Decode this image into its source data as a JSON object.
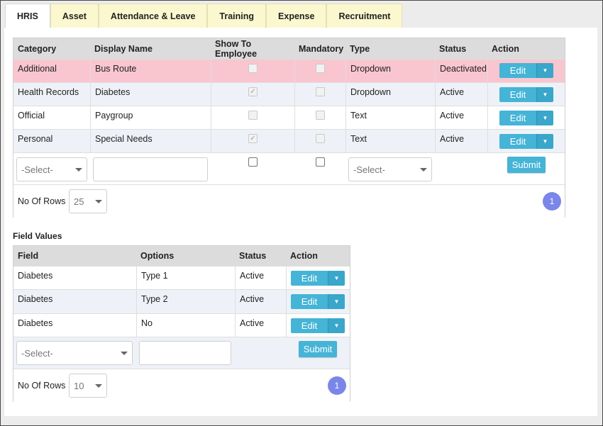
{
  "tabs": [
    {
      "label": "HRIS",
      "active": true
    },
    {
      "label": "Asset"
    },
    {
      "label": "Attendance & Leave"
    },
    {
      "label": "Training"
    },
    {
      "label": "Expense"
    },
    {
      "label": "Recruitment"
    }
  ],
  "fields_table": {
    "headers": [
      "Category",
      "Display Name",
      "Show To Employee",
      "Mandatory",
      "Type",
      "Status",
      "Action"
    ],
    "rows": [
      {
        "category": "Additional",
        "display_name": "Bus Route",
        "show_to_employee": false,
        "mandatory": false,
        "type": "Dropdown",
        "status": "Deactivated",
        "action": "Edit"
      },
      {
        "category": "Health Records",
        "display_name": "Diabetes",
        "show_to_employee": true,
        "mandatory": false,
        "type": "Dropdown",
        "status": "Active",
        "action": "Edit"
      },
      {
        "category": "Official",
        "display_name": "Paygroup",
        "show_to_employee": false,
        "mandatory": false,
        "type": "Text",
        "status": "Active",
        "action": "Edit"
      },
      {
        "category": "Personal",
        "display_name": "Special Needs",
        "show_to_employee": true,
        "mandatory": false,
        "type": "Text",
        "status": "Active",
        "action": "Edit"
      }
    ],
    "form": {
      "category_select": "-Select-",
      "display_name_value": "",
      "show_to_employee": false,
      "mandatory": false,
      "type_select": "-Select-",
      "submit_label": "Submit"
    },
    "pager": {
      "rows_label": "No Of Rows :",
      "rows_value": "25",
      "page": "1"
    }
  },
  "field_values": {
    "title": "Field Values",
    "headers": [
      "Field",
      "Options",
      "Status",
      "Action"
    ],
    "rows": [
      {
        "field": "Diabetes",
        "options": "Type 1",
        "status": "Active",
        "action": "Edit"
      },
      {
        "field": "Diabetes",
        "options": "Type 2",
        "status": "Active",
        "action": "Edit"
      },
      {
        "field": "Diabetes",
        "options": "No",
        "status": "Active",
        "action": "Edit"
      }
    ],
    "form": {
      "field_select": "-Select-",
      "options_value": "",
      "submit_label": "Submit"
    },
    "pager": {
      "rows_label": "No Of Rows :",
      "rows_value": "10",
      "page": "1"
    }
  },
  "icons": {
    "checkmark": "check-icon",
    "caret": "caret-down-icon"
  },
  "colors": {
    "button": "#45b4d6",
    "deactivated_row": "#f9c6cf",
    "page_badge": "#7a86e8",
    "tab_inactive": "#fbf8d0"
  }
}
